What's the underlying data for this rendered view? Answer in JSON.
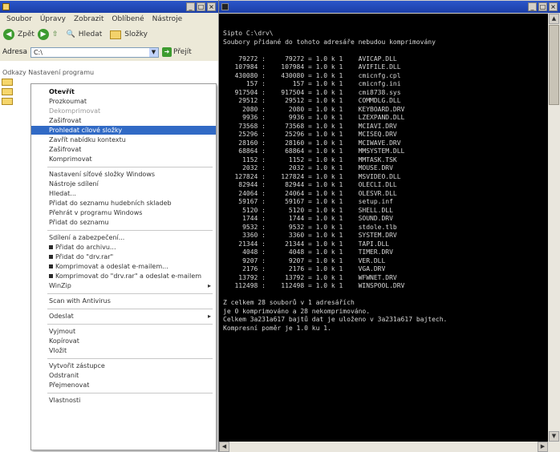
{
  "explorer": {
    "title": "",
    "menu": [
      "Soubor",
      "Úpravy",
      "Zobrazit",
      "Oblíbené",
      "Nástroje"
    ],
    "toolbar": {
      "back": "Zpět",
      "search": "Hledat",
      "folders": "Složky"
    },
    "address": {
      "label": "Adresa",
      "value": "C:\\",
      "go": "Přejít"
    },
    "breadcrumb": "Odkazy   Nastavení programu",
    "context_menu": [
      {
        "label": "Otevřít",
        "bold": true
      },
      {
        "label": "Prozkoumat"
      },
      {
        "label": "Dekomprimovat",
        "disabled": true
      },
      {
        "label": "Zašifrovat"
      },
      {
        "label": "Prohledat cílové složky",
        "highlight": true
      },
      {
        "label": "Zavřít nabídku kontextu"
      },
      {
        "label": "Zašifrovat"
      },
      {
        "label": "Komprimovat"
      },
      {
        "sep": true
      },
      {
        "label": "Nastavení síťové složky Windows"
      },
      {
        "label": "Nástroje sdílení"
      },
      {
        "label": "Hledat..."
      },
      {
        "label": "Přidat do seznamu hudebních skladeb"
      },
      {
        "label": "Přehrát v programu Windows"
      },
      {
        "label": "Přidat do seznamu"
      },
      {
        "sep": true
      },
      {
        "label": "Sdílení a zabezpečení..."
      },
      {
        "label": "Přidat do archivu...",
        "sq": true
      },
      {
        "label": "Přidat do \"drv.rar\"",
        "sq": true
      },
      {
        "label": "Komprimovat a odeslat e-mailem...",
        "sq": true
      },
      {
        "label": "Komprimovat do \"drv.rar\" a odeslat e-mailem",
        "sq": true
      },
      {
        "label": "WinZip",
        "arrow": true
      },
      {
        "sep": true
      },
      {
        "label": "Scan with Antivirus",
        "arrow": false
      },
      {
        "sep": true
      },
      {
        "label": "Odeslat",
        "arrow": true
      },
      {
        "sep": true
      },
      {
        "label": "Vyjmout"
      },
      {
        "label": "Kopírovat"
      },
      {
        "label": "Vložit"
      },
      {
        "sep": true
      },
      {
        "label": "Vytvořit zástupce"
      },
      {
        "label": "Odstranit"
      },
      {
        "label": "Přejmenovat"
      },
      {
        "sep": true
      },
      {
        "label": "Vlastnosti"
      }
    ]
  },
  "console": {
    "title": "",
    "header": [
      "Sipto C:\\drv\\",
      "Soubory přidané do tohoto adresáře nebudou komprimovány"
    ],
    "rows": [
      [
        "79272",
        "79272",
        "1.0",
        "AVICAP.DLL"
      ],
      [
        "107984",
        "107984",
        "1.0",
        "AVIFILE.DLL"
      ],
      [
        "430080",
        "430080",
        "1.0",
        "cmicnfg.cpl"
      ],
      [
        "157",
        "157",
        "1.0",
        "cmicnfg.ini"
      ],
      [
        "917504",
        "917504",
        "1.0",
        "cmi8738.sys"
      ],
      [
        "29512",
        "29512",
        "1.0",
        "COMMDLG.DLL"
      ],
      [
        "2080",
        "2080",
        "1.0",
        "KEYBOARD.DRV"
      ],
      [
        "9936",
        "9936",
        "1.0",
        "LZEXPAND.DLL"
      ],
      [
        "73568",
        "73568",
        "1.0",
        "MCIAVI.DRV"
      ],
      [
        "25296",
        "25296",
        "1.0",
        "MCISEQ.DRV"
      ],
      [
        "28160",
        "28160",
        "1.0",
        "MCIWAVE.DRV"
      ],
      [
        "68864",
        "68864",
        "1.0",
        "MMSYSTEM.DLL"
      ],
      [
        "1152",
        "1152",
        "1.0",
        "MMTASK.TSK"
      ],
      [
        "2032",
        "2032",
        "1.0",
        "MOUSE.DRV"
      ],
      [
        "127824",
        "127824",
        "1.0",
        "MSVIDEO.DLL"
      ],
      [
        "82944",
        "82944",
        "1.0",
        "OLECLI.DLL"
      ],
      [
        "24064",
        "24064",
        "1.0",
        "OLESVR.DLL"
      ],
      [
        "59167",
        "59167",
        "1.0",
        "setup.inf"
      ],
      [
        "5120",
        "5120",
        "1.0",
        "SHELL.DLL"
      ],
      [
        "1744",
        "1744",
        "1.0",
        "SOUND.DRV"
      ],
      [
        "9532",
        "9532",
        "1.0",
        "stdole.tlb"
      ],
      [
        "3360",
        "3360",
        "1.0",
        "SYSTEM.DRV"
      ],
      [
        "21344",
        "21344",
        "1.0",
        "TAPI.DLL"
      ],
      [
        "4048",
        "4048",
        "1.0",
        "TIMER.DRV"
      ],
      [
        "9207",
        "9207",
        "1.0",
        "VER.DLL"
      ],
      [
        "2176",
        "2176",
        "1.0",
        "VGA.DRV"
      ],
      [
        "13792",
        "13792",
        "1.0",
        "WFWNET.DRV"
      ],
      [
        "112498",
        "112498",
        "1.0",
        "WINSPOOL.DRV"
      ]
    ],
    "footer": [
      "Z celkem 28 souborů v 1 adresářích",
      "je 0 komprimováno a 28 nekomprimováno.",
      "Celkem 3a231a617 bajtů dat je uloženo v 3a231a617 bajtech.",
      "Kompresní poměr je 1.0 ku 1."
    ]
  }
}
